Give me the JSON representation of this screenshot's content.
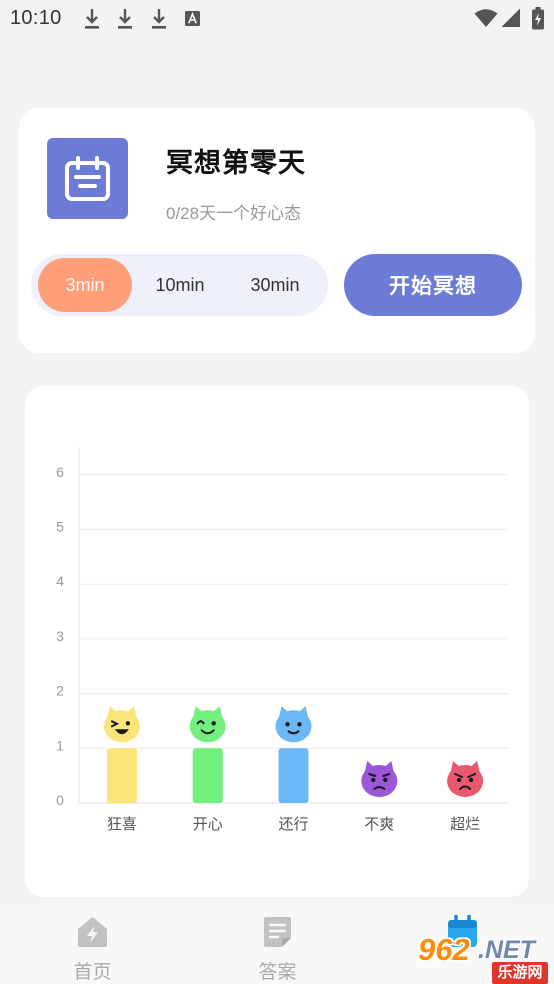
{
  "status_bar": {
    "time": "10:10",
    "left_icons": [
      "download-icon",
      "download-icon",
      "download-icon",
      "a-letter-icon"
    ],
    "right_icons": [
      "wifi-icon",
      "signal-icon",
      "battery-icon"
    ]
  },
  "meditation": {
    "icon": "calendar-icon",
    "title": "冥想第零天",
    "subtitle": "0/28天一个好心态",
    "durations": [
      {
        "label": "3min",
        "selected": true
      },
      {
        "label": "10min",
        "selected": false
      },
      {
        "label": "30min",
        "selected": false
      }
    ],
    "start_label": "开始冥想",
    "colors": {
      "accent": "#6b7bd6",
      "selected": "#ff9f7a",
      "selector_bg": "#eef0fa"
    }
  },
  "chart_data": {
    "type": "bar",
    "categories": [
      "狂喜",
      "开心",
      "还行",
      "不爽",
      "超烂"
    ],
    "values": [
      1,
      1,
      1,
      0,
      0
    ],
    "yticks": [
      "0",
      "1",
      "2",
      "3",
      "4",
      "5",
      "6"
    ],
    "ylim": [
      0,
      6
    ],
    "grid": true,
    "colors": [
      "#fce578",
      "#72ef7c",
      "#6cb8f6",
      "#9a58d8",
      "#e9586f"
    ],
    "face_icons": [
      "ecstatic-face-icon",
      "happy-face-icon",
      "okay-face-icon",
      "upset-face-icon",
      "awful-face-icon"
    ]
  },
  "bottom_nav": {
    "items": [
      {
        "label": "首页",
        "icon": "home-icon",
        "active": false
      },
      {
        "label": "答案",
        "icon": "document-icon",
        "active": false
      },
      {
        "icon": "calendar-icon",
        "active": true
      }
    ],
    "colors": {
      "inactive": "#c2c2c2",
      "active": "#2aa6f0"
    }
  },
  "watermark": {
    "number": "962",
    "domain": ".NET",
    "name": "乐游网"
  }
}
